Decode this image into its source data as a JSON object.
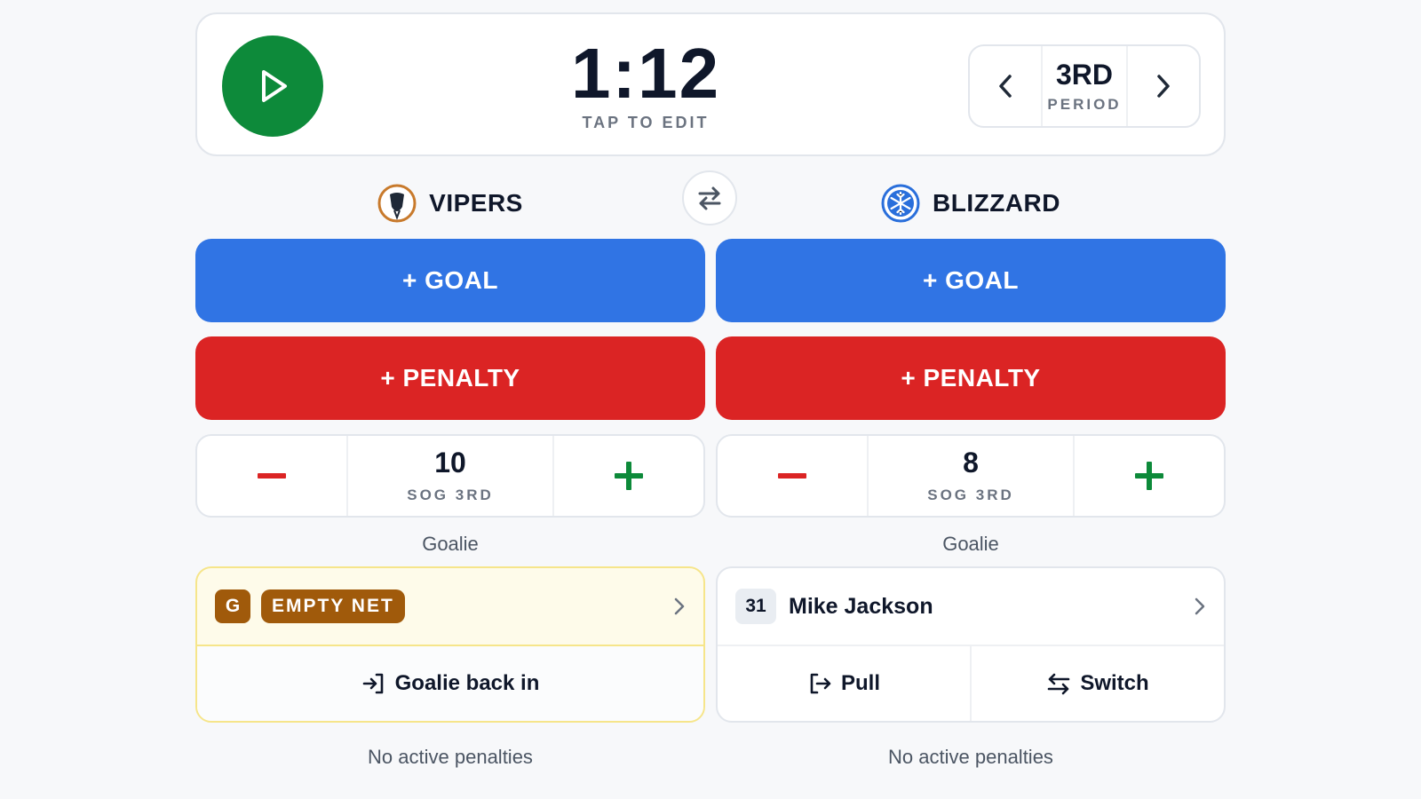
{
  "clock": {
    "time": "1:12",
    "hint": "TAP TO EDIT"
  },
  "period": {
    "number": "3RD",
    "label": "PERIOD"
  },
  "colors": {
    "goal": "#3074e4",
    "penalty": "#db2424",
    "play": "#0d8a3a",
    "empty_net": "#a05a0b"
  },
  "teams": {
    "home": {
      "name": "VIPERS",
      "logo_icon": "viper-logo-icon",
      "goal_label": "+ GOAL",
      "penalty_label": "+ PENALTY",
      "sog": {
        "value": "10",
        "label": "SOG 3RD"
      },
      "goalie_caption": "Goalie",
      "goalie": {
        "badge": "G",
        "status": "EMPTY NET",
        "action": "Goalie back in"
      },
      "penalties_text": "No active penalties"
    },
    "away": {
      "name": "BLIZZARD",
      "logo_icon": "snowflake-logo-icon",
      "goal_label": "+ GOAL",
      "penalty_label": "+ PENALTY",
      "sog": {
        "value": "8",
        "label": "SOG 3RD"
      },
      "goalie_caption": "Goalie",
      "goalie": {
        "number": "31",
        "name": "Mike Jackson",
        "pull_label": "Pull",
        "switch_label": "Switch"
      },
      "penalties_text": "No active penalties"
    }
  }
}
